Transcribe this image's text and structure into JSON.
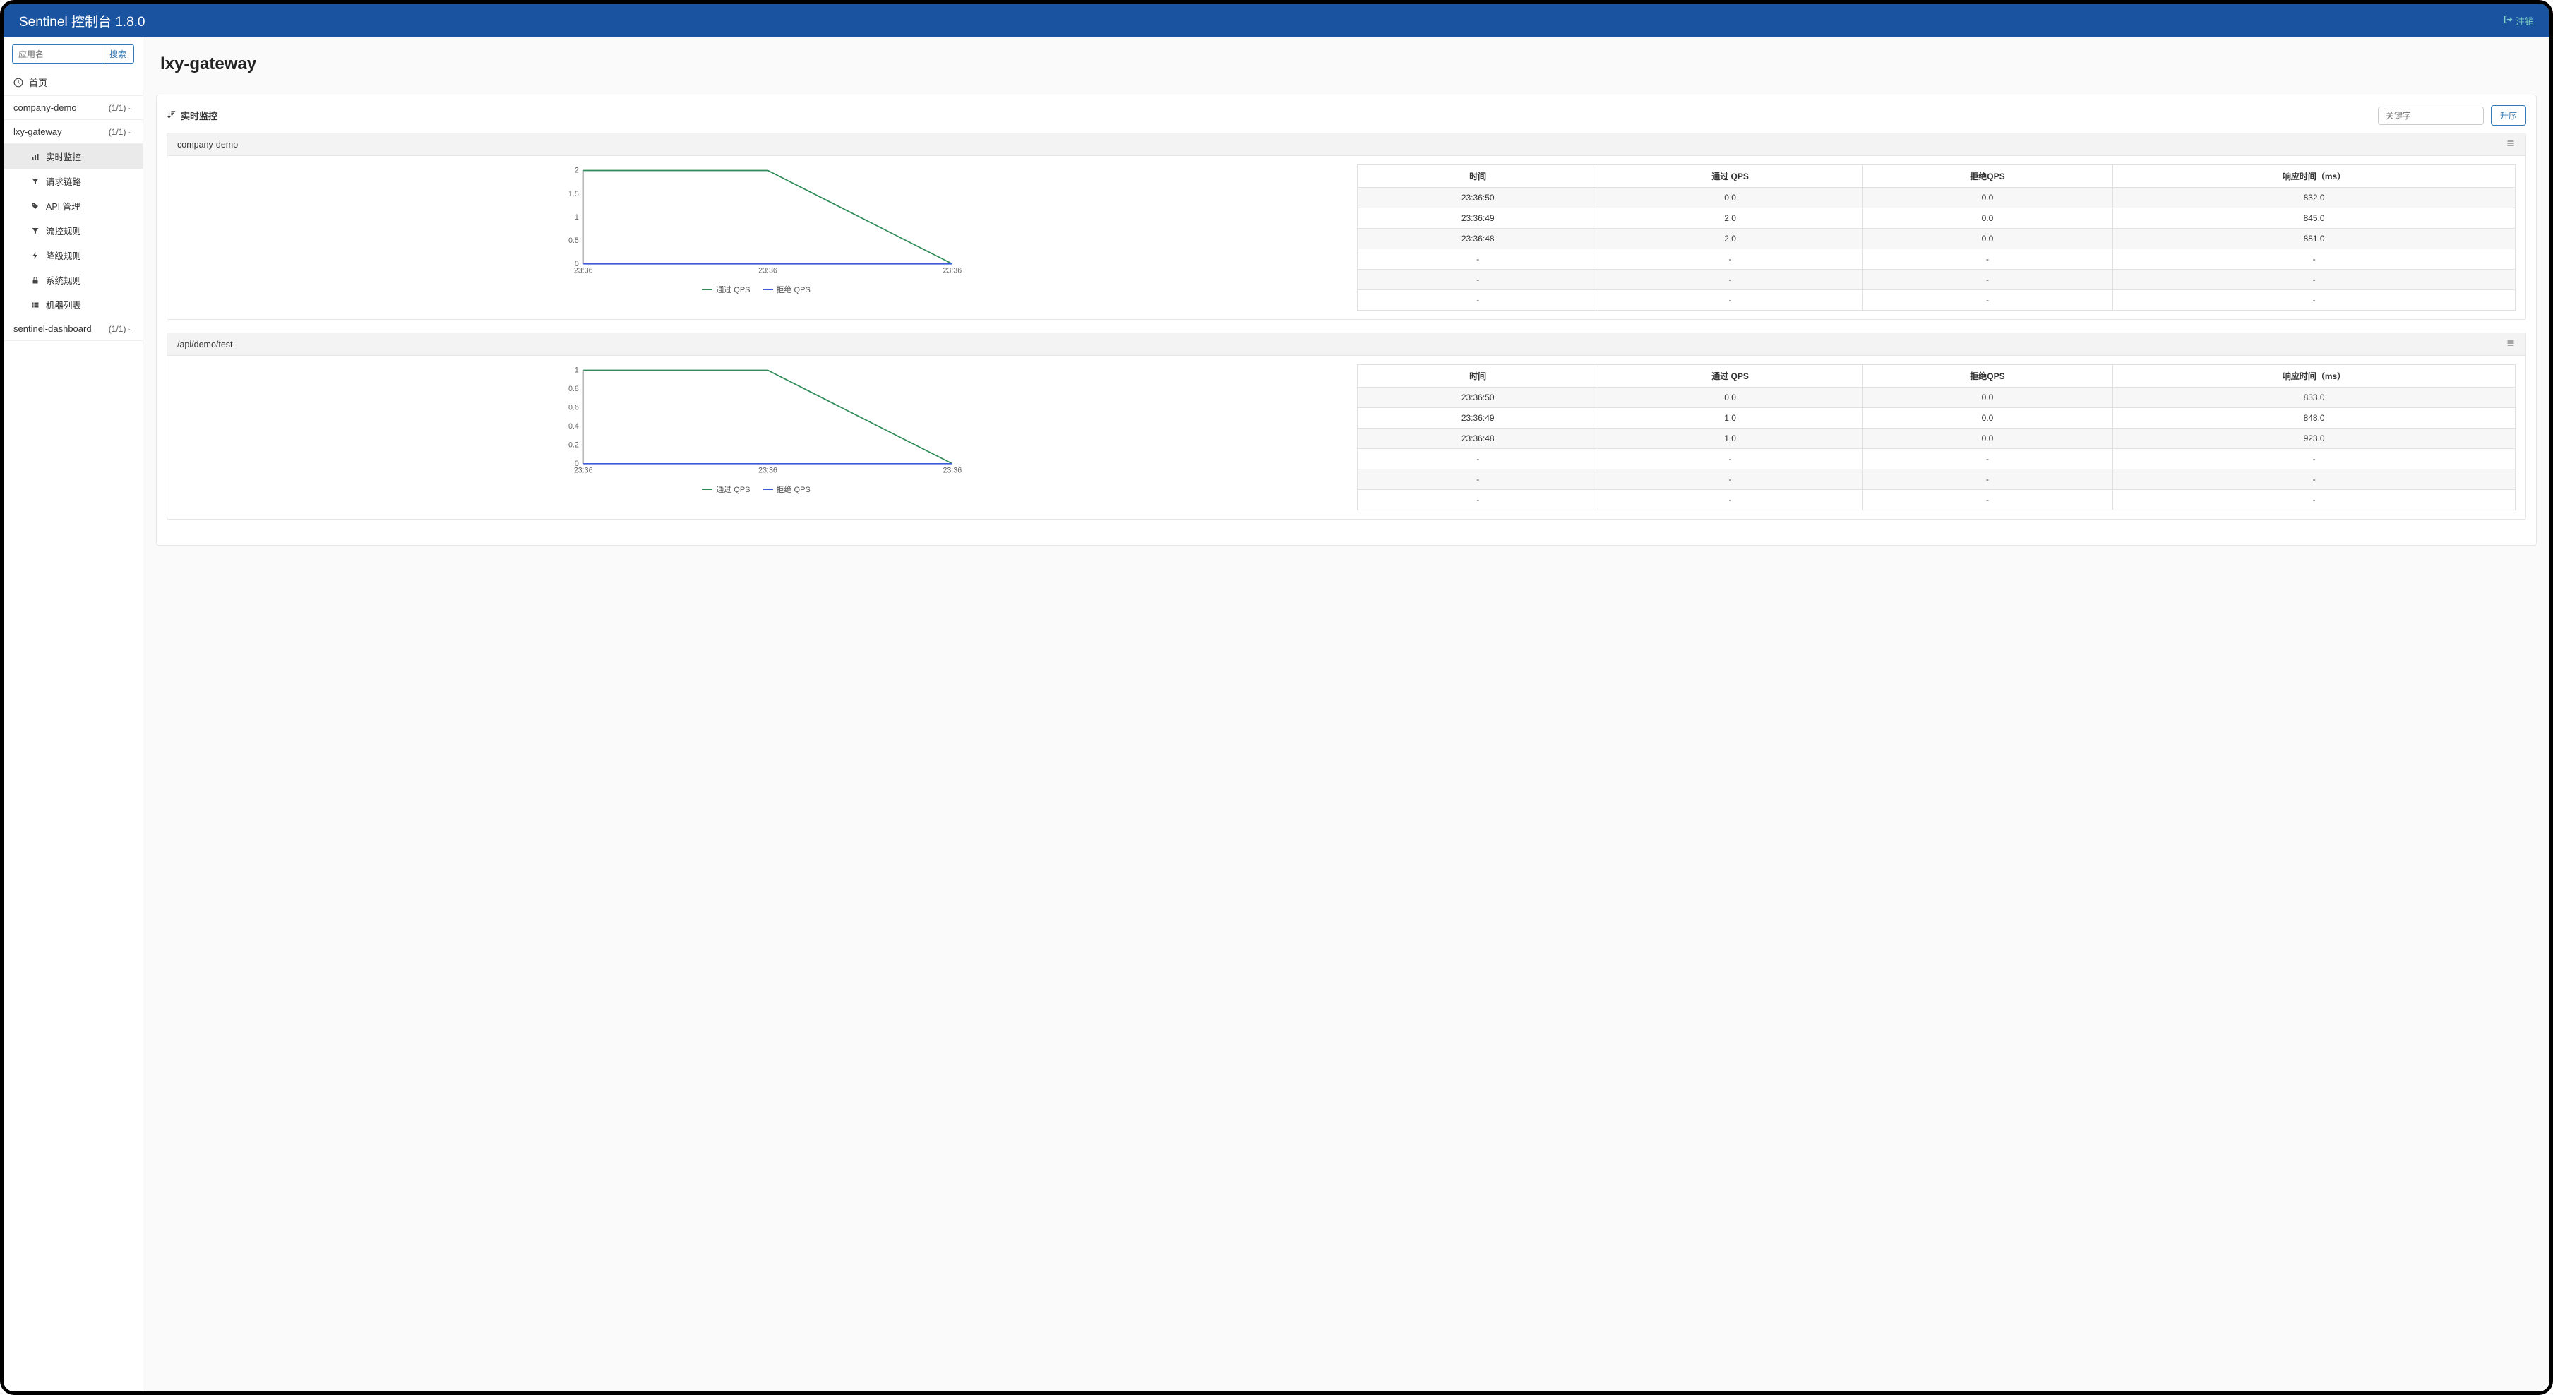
{
  "header": {
    "title": "Sentinel 控制台 1.8.0",
    "logout": "注销"
  },
  "sidebar": {
    "search_placeholder": "应用名",
    "search_button": "搜索",
    "home": "首页",
    "apps": [
      {
        "name": "company-demo",
        "count": "(1/1)"
      },
      {
        "name": "lxy-gateway",
        "count": "(1/1)"
      },
      {
        "name": "sentinel-dashboard",
        "count": "(1/1)"
      }
    ],
    "submenu": [
      {
        "icon": "chart-bar",
        "label": "实时监控"
      },
      {
        "icon": "filter",
        "label": "请求链路"
      },
      {
        "icon": "tags",
        "label": "API 管理"
      },
      {
        "icon": "filter",
        "label": "流控规则"
      },
      {
        "icon": "bolt",
        "label": "降级规则"
      },
      {
        "icon": "lock",
        "label": "系统规则"
      },
      {
        "icon": "list",
        "label": "机器列表"
      }
    ]
  },
  "main": {
    "title": "lxy-gateway",
    "panel_title": "实时监控",
    "keyword_placeholder": "关键字",
    "sort_button": "升序",
    "table_headers": [
      "时间",
      "通过 QPS",
      "拒绝QPS",
      "响应时间（ms）"
    ],
    "legend_pass": "通过 QPS",
    "legend_block": "拒绝 QPS",
    "resources": [
      {
        "name": "company-demo",
        "x_ticks": [
          "23:36",
          "23:36",
          "23:36"
        ],
        "y_ticks": [
          "0",
          "0.5",
          "1",
          "1.5",
          "2"
        ],
        "rows": [
          [
            "23:36:50",
            "0.0",
            "0.0",
            "832.0"
          ],
          [
            "23:36:49",
            "2.0",
            "0.0",
            "845.0"
          ],
          [
            "23:36:48",
            "2.0",
            "0.0",
            "881.0"
          ],
          [
            "-",
            "-",
            "-",
            "-"
          ],
          [
            "-",
            "-",
            "-",
            "-"
          ],
          [
            "-",
            "-",
            "-",
            "-"
          ]
        ]
      },
      {
        "name": "/api/demo/test",
        "x_ticks": [
          "23:36",
          "23:36",
          "23:36"
        ],
        "y_ticks": [
          "0",
          "0.2",
          "0.4",
          "0.6",
          "0.8",
          "1"
        ],
        "rows": [
          [
            "23:36:50",
            "0.0",
            "0.0",
            "833.0"
          ],
          [
            "23:36:49",
            "1.0",
            "0.0",
            "848.0"
          ],
          [
            "23:36:48",
            "1.0",
            "0.0",
            "923.0"
          ],
          [
            "-",
            "-",
            "-",
            "-"
          ],
          [
            "-",
            "-",
            "-",
            "-"
          ],
          [
            "-",
            "-",
            "-",
            "-"
          ]
        ]
      }
    ]
  },
  "chart_data": [
    {
      "type": "line",
      "title": "company-demo",
      "xlabel": "",
      "ylabel": "",
      "x": [
        "23:36",
        "23:36",
        "23:36"
      ],
      "ylim": [
        0,
        2
      ],
      "series": [
        {
          "name": "通过 QPS",
          "color": "#2e8b57",
          "values": [
            2,
            2,
            0
          ]
        },
        {
          "name": "拒绝 QPS",
          "color": "#3b5bdb",
          "values": [
            0,
            0,
            0
          ]
        }
      ]
    },
    {
      "type": "line",
      "title": "/api/demo/test",
      "xlabel": "",
      "ylabel": "",
      "x": [
        "23:36",
        "23:36",
        "23:36"
      ],
      "ylim": [
        0,
        1
      ],
      "series": [
        {
          "name": "通过 QPS",
          "color": "#2e8b57",
          "values": [
            1,
            1,
            0
          ]
        },
        {
          "name": "拒绝 QPS",
          "color": "#3b5bdb",
          "values": [
            0,
            0,
            0
          ]
        }
      ]
    }
  ]
}
